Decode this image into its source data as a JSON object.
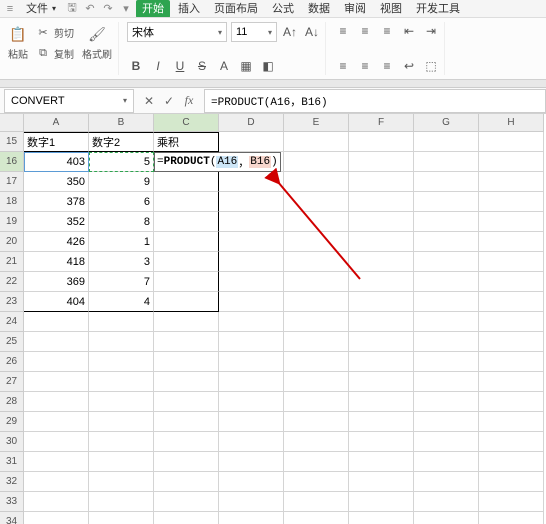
{
  "menu": {
    "file": "文件",
    "start": "开始",
    "insert": "插入",
    "layout": "页面布局",
    "formula": "公式",
    "data": "数据",
    "review": "审阅",
    "view": "视图",
    "dev": "开发工具"
  },
  "ribbon": {
    "paste": "粘贴",
    "cut": "剪切",
    "copy": "复制",
    "fmt": "格式刷",
    "font": "宋体",
    "size": "11"
  },
  "formulabar": {
    "name": "CONVERT",
    "formula": "=PRODUCT(A16，B16)"
  },
  "editing": {
    "prefix": "=",
    "func": "PRODUCT",
    "open": "(",
    "arg1": "A16",
    "sep": "，",
    "arg2": "B16",
    "close": ")"
  },
  "columns": [
    "A",
    "B",
    "C",
    "D",
    "E",
    "F",
    "G",
    "H"
  ],
  "rows_start": 15,
  "headers": {
    "a": "数字1",
    "b": "数字2",
    "c": "乘积"
  },
  "datarows": [
    {
      "a": "403",
      "b": "5"
    },
    {
      "a": "350",
      "b": "9"
    },
    {
      "a": "378",
      "b": "6"
    },
    {
      "a": "352",
      "b": "8"
    },
    {
      "a": "426",
      "b": "1"
    },
    {
      "a": "418",
      "b": "3"
    },
    {
      "a": "369",
      "b": "7"
    },
    {
      "a": "404",
      "b": "4"
    }
  ],
  "chart_data": {
    "type": "table",
    "columns": [
      "数字1",
      "数字2",
      "乘积"
    ],
    "rows": [
      [
        403,
        5,
        null
      ],
      [
        350,
        9,
        null
      ],
      [
        378,
        6,
        null
      ],
      [
        352,
        8,
        null
      ],
      [
        426,
        1,
        null
      ],
      [
        418,
        3,
        null
      ],
      [
        369,
        7,
        null
      ],
      [
        404,
        4,
        null
      ]
    ]
  }
}
